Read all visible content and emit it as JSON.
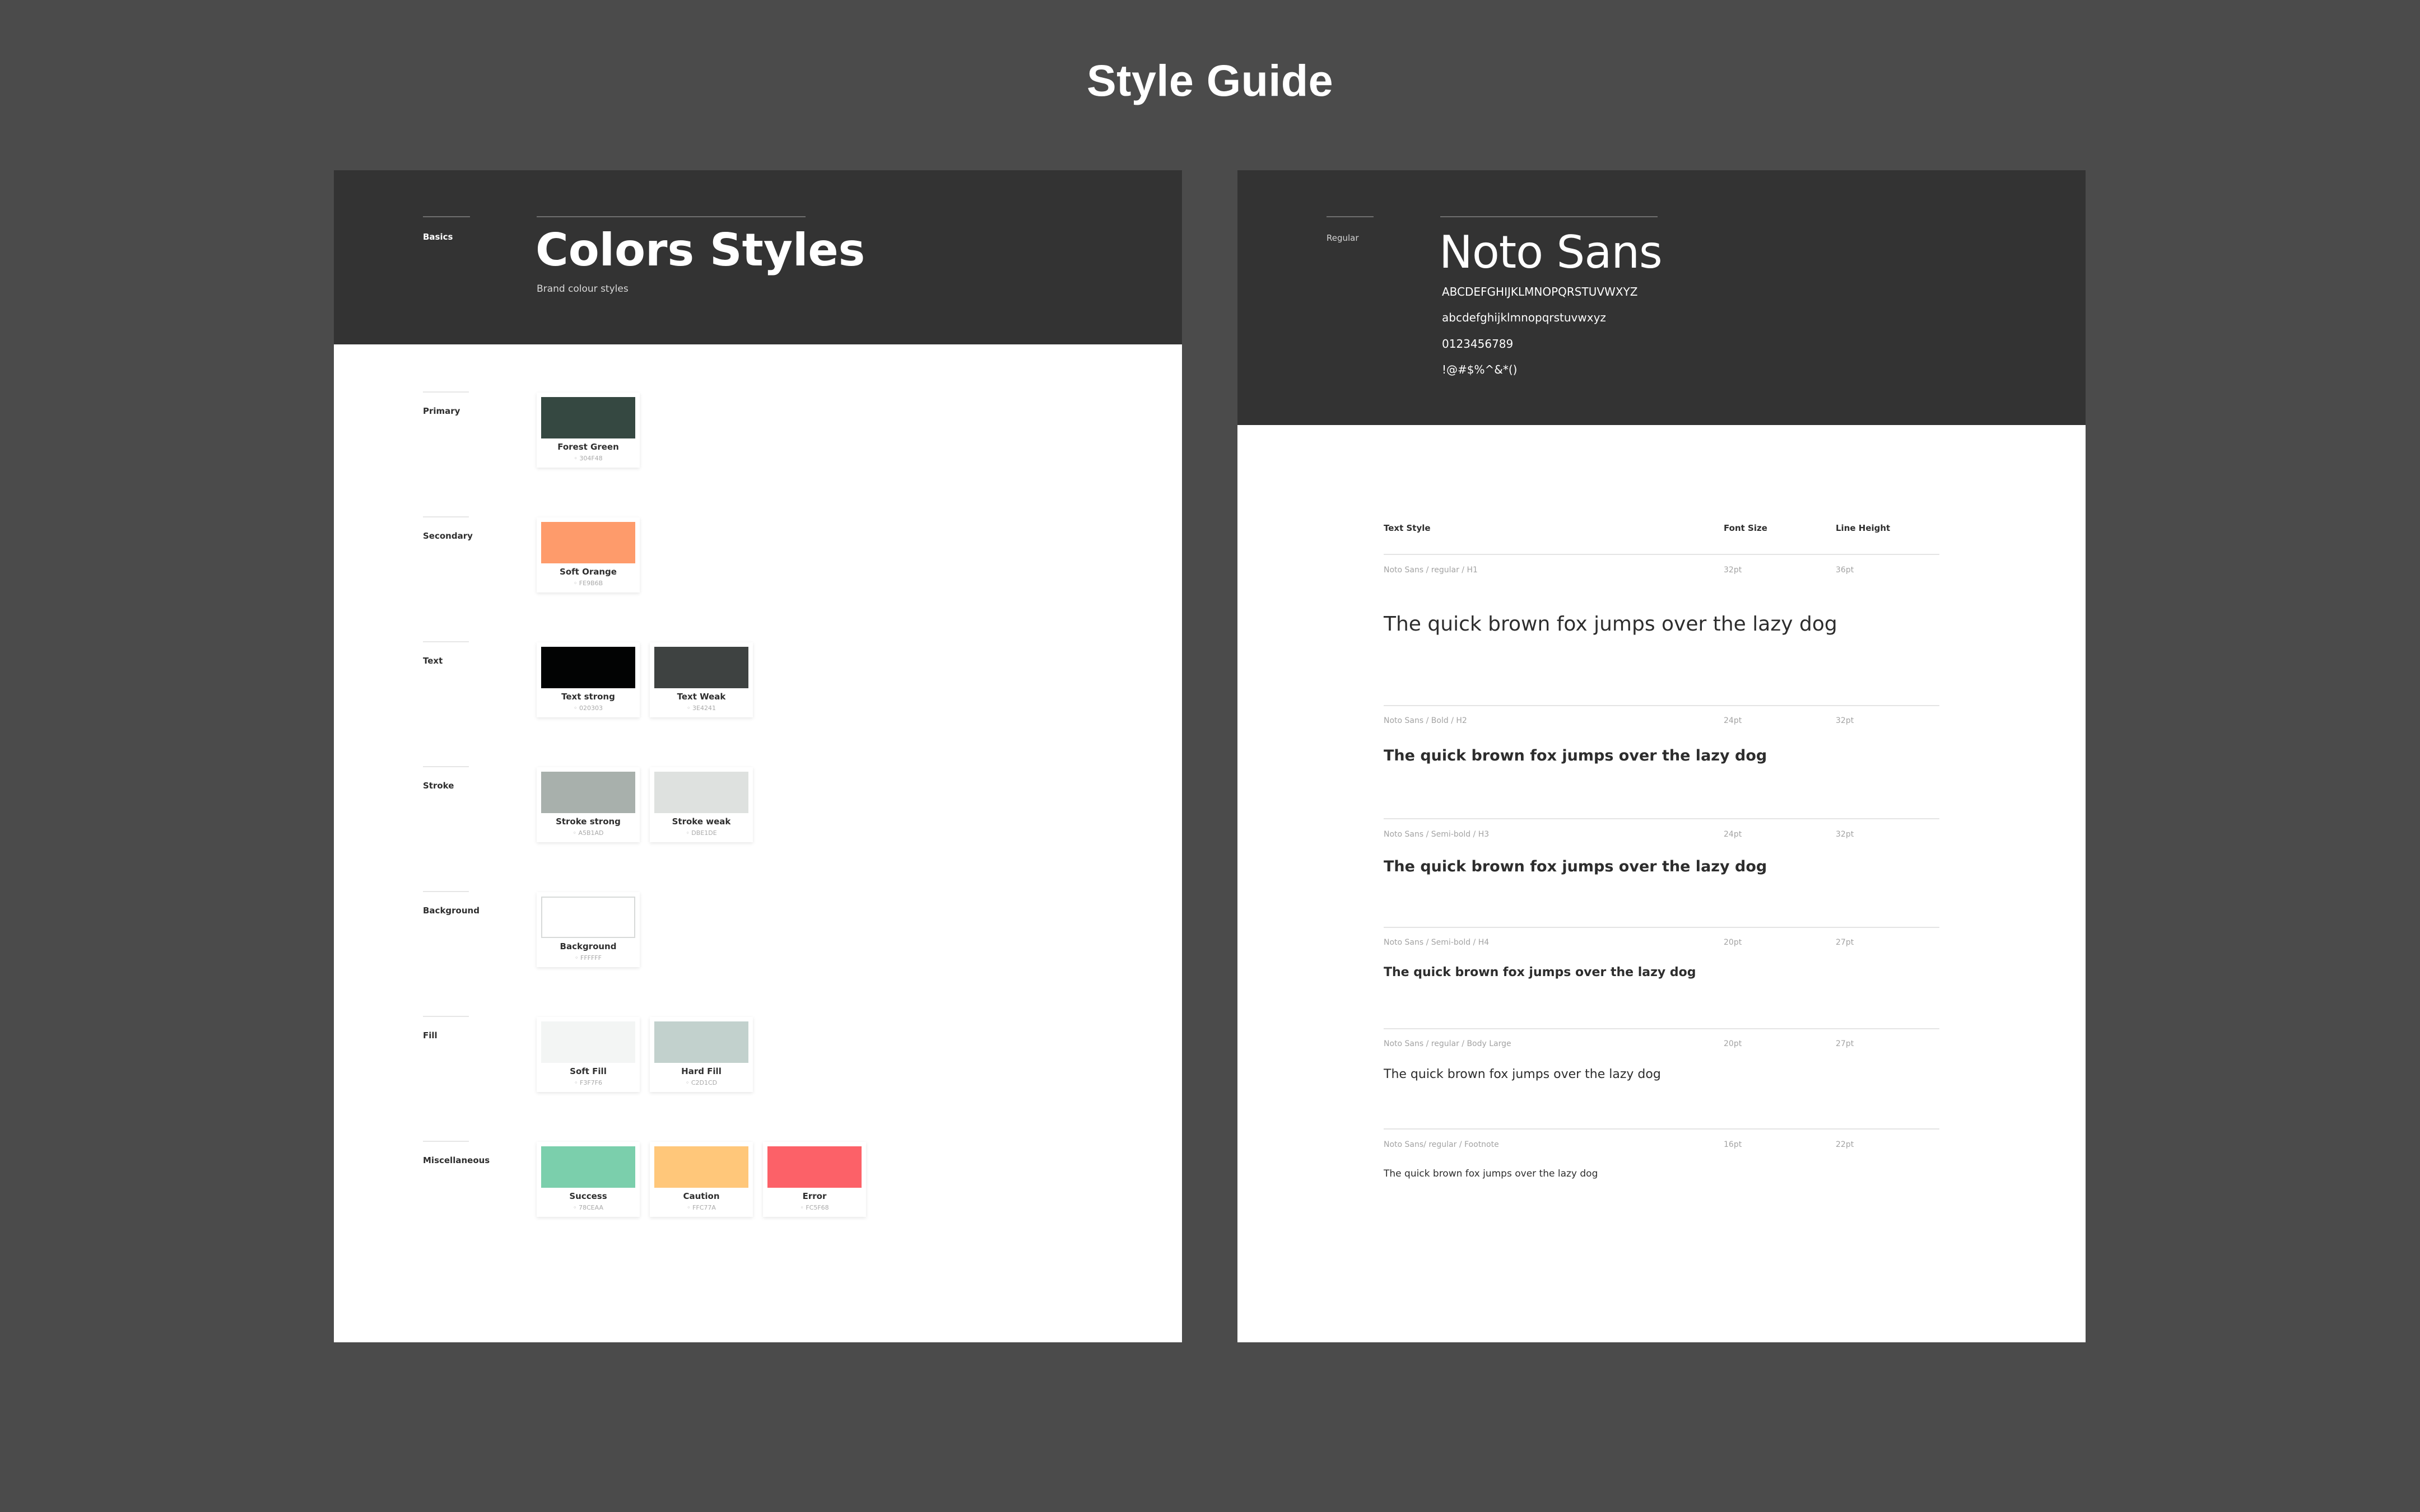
{
  "page": {
    "title": "Style Guide"
  },
  "colors_panel": {
    "section_label": "Basics",
    "title": "Colors Styles",
    "subtitle": "Brand colour styles",
    "groups": [
      {
        "label": "Primary",
        "swatches": [
          {
            "name": "Forest Green",
            "hex": "◦ 304F48",
            "color": "#354841"
          }
        ]
      },
      {
        "label": "Secondary",
        "swatches": [
          {
            "name": "Soft Orange",
            "hex": "◦ FE9B6B",
            "color": "#FE9B6B"
          }
        ]
      },
      {
        "label": "Text",
        "swatches": [
          {
            "name": "Text strong",
            "hex": "◦ 020303",
            "color": "#020303"
          },
          {
            "name": "Text Weak",
            "hex": "◦ 3E4241",
            "color": "#3E4241"
          }
        ]
      },
      {
        "label": "Stroke",
        "swatches": [
          {
            "name": "Stroke strong",
            "hex": "◦ A5B1AD",
            "color": "#A8B0AC"
          },
          {
            "name": "Stroke weak",
            "hex": "◦ DBE1DE",
            "color": "#DEE1DF"
          }
        ]
      },
      {
        "label": "Background",
        "swatches": [
          {
            "name": "Background",
            "hex": "◦ FFFFFF",
            "color": "#FFFFFF"
          }
        ]
      },
      {
        "label": "Fill",
        "swatches": [
          {
            "name": "Soft Fill",
            "hex": "◦ F3F7F6",
            "color": "#F3F5F4"
          },
          {
            "name": "Hard Fill",
            "hex": "◦ C2D1CD",
            "color": "#C2D1CD"
          }
        ]
      },
      {
        "label": "Miscellaneous",
        "swatches": [
          {
            "name": "Success",
            "hex": "◦ 78CEAA",
            "color": "#7BCFAC"
          },
          {
            "name": "Caution",
            "hex": "◦ FFC77A",
            "color": "#FFC77A"
          },
          {
            "name": "Error",
            "hex": "◦ FC5F68",
            "color": "#FC6168"
          }
        ]
      }
    ]
  },
  "typography_panel": {
    "section_label": "Regular",
    "font_name": "Noto Sans",
    "charsets": [
      "ABCDEFGHIJKLMNOPQRSTUVWXYZ",
      "abcdefghijklmnopqrstuvwxyz",
      "0123456789",
      "!@#$%^&*()"
    ],
    "table_headers": {
      "style": "Text Style",
      "size": "Font Size",
      "line_height": "Line Height"
    },
    "rows": [
      {
        "style": "Noto Sans / regular / H1",
        "size": "32pt",
        "line_height": "36pt",
        "sample": "The quick brown fox jumps over the lazy dog"
      },
      {
        "style": "Noto Sans / Bold / H2",
        "size": "24pt",
        "line_height": "32pt",
        "sample": "The quick brown fox jumps over the lazy dog"
      },
      {
        "style": "Noto Sans / Semi-bold / H3",
        "size": "24pt",
        "line_height": "32pt",
        "sample": "The quick brown fox jumps over the lazy dog"
      },
      {
        "style": "Noto Sans / Semi-bold / H4",
        "size": "20pt",
        "line_height": "27pt",
        "sample": "The quick brown fox jumps over the lazy dog"
      },
      {
        "style": "Noto Sans / regular / Body Large",
        "size": "20pt",
        "line_height": "27pt",
        "sample": "The quick brown fox jumps over the lazy dog"
      },
      {
        "style": "Noto Sans/ regular / Footnote",
        "size": "16pt",
        "line_height": "22pt",
        "sample": "The quick brown fox jumps over the lazy dog"
      }
    ]
  }
}
